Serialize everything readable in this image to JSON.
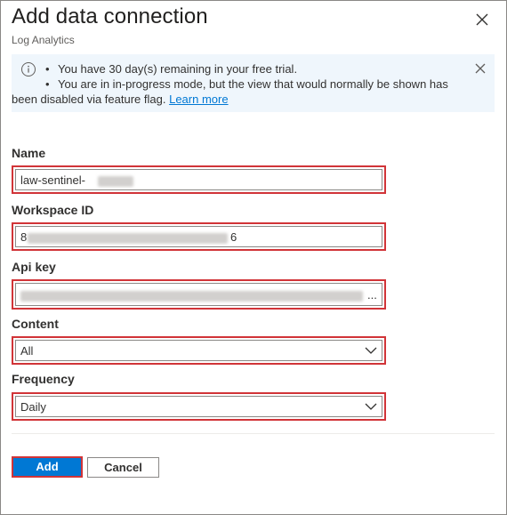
{
  "header": {
    "title": "Add data connection",
    "subtitle": "Log Analytics",
    "close_icon": "close-icon"
  },
  "banner": {
    "info_icon": "info-icon",
    "line1": "You have 30 day(s) remaining in your free trial.",
    "line2": "You are in in-progress mode, but the view that would normally be shown has",
    "line3": "been disabled via feature flag.",
    "link": "Learn more",
    "close_icon": "close-icon"
  },
  "form": {
    "name": {
      "label": "Name",
      "value": "law-sentinel-"
    },
    "workspace_id": {
      "label": "Workspace ID",
      "value_start": "8",
      "value_end": "6"
    },
    "api_key": {
      "label": "Api key",
      "value_end": "..."
    },
    "content": {
      "label": "Content",
      "value": "All"
    },
    "frequency": {
      "label": "Frequency",
      "value": "Daily"
    }
  },
  "buttons": {
    "add": "Add",
    "cancel": "Cancel"
  },
  "colors": {
    "primary": "#0078d4",
    "highlight": "#d13438",
    "banner_bg": "#eff6fc"
  }
}
